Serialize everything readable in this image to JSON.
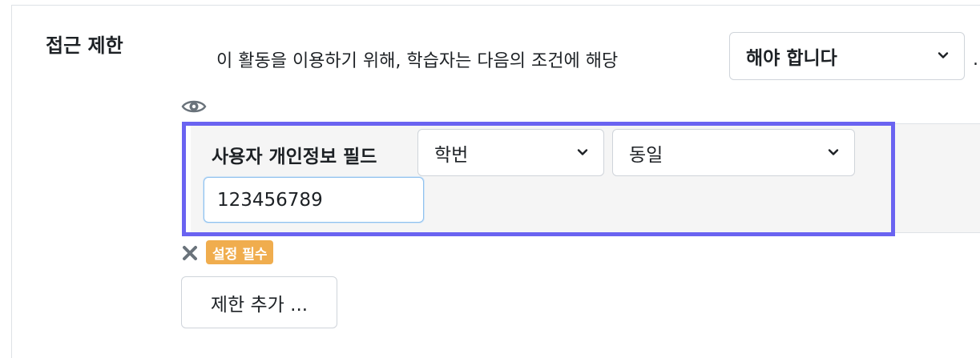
{
  "section": {
    "label": "접근 제한"
  },
  "restriction": {
    "condition_text": "이 활동을 이용하기 위해, 학습자는 다음의 조건에 해당",
    "must_select_value": "해야 합니다",
    "trailing_text": "."
  },
  "condition": {
    "field_label": "사용자 개인정보 필드",
    "field_select_value": "학번",
    "operator_select_value": "동일",
    "value_input": "123456789",
    "required_badge": "설정 필수"
  },
  "actions": {
    "add_restriction_label": "제한 추가 ..."
  },
  "colors": {
    "highlight_border": "#6a63f1",
    "badge_bg": "#f0ad4e",
    "condition_bg": "#f5f5f5"
  },
  "icons": {
    "eye": "eye-icon",
    "delete": "close-icon",
    "dropdown": "chevron-down-icon"
  }
}
